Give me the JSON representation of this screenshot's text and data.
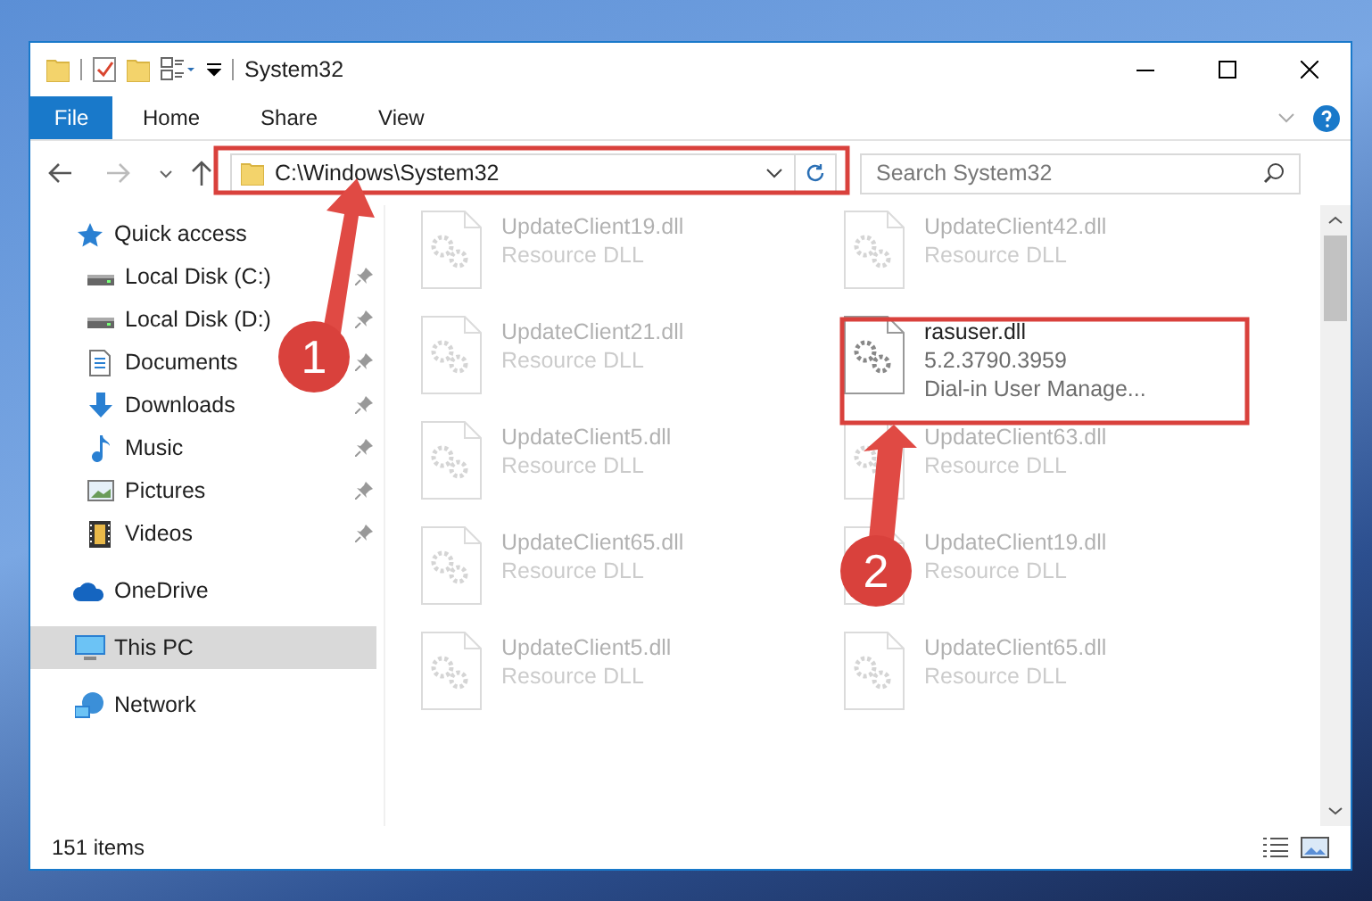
{
  "window": {
    "title": "System32"
  },
  "ribbon_tabs": [
    {
      "label": "File",
      "kind": "file"
    },
    {
      "label": "Home",
      "kind": "tab"
    },
    {
      "label": "Share",
      "kind": "tab"
    },
    {
      "label": "View",
      "kind": "tab"
    }
  ],
  "address_bar": {
    "path": "C:\\Windows\\System32"
  },
  "search": {
    "placeholder": "Search System32"
  },
  "sidebar": {
    "items": [
      {
        "label": "Quick access",
        "selected": false,
        "children": [
          {
            "label": "Local Disk (C:)",
            "pinned": true,
            "selected": false
          },
          {
            "label": "Local Disk (D:)",
            "pinned": true,
            "selected": false
          },
          {
            "label": "Documents",
            "pinned": true,
            "selected": false
          },
          {
            "label": "Downloads",
            "pinned": true,
            "selected": false
          },
          {
            "label": "Music",
            "pinned": true,
            "selected": false
          },
          {
            "label": "Pictures",
            "pinned": true,
            "selected": false
          },
          {
            "label": "Videos",
            "pinned": true,
            "selected": false
          }
        ]
      },
      {
        "label": "OneDrive",
        "selected": false
      },
      {
        "label": "This PC",
        "selected": true
      },
      {
        "label": "Network",
        "selected": false
      }
    ]
  },
  "files": [
    {
      "name": "UpdateClient19.dll",
      "details": [
        "Resource DLL"
      ],
      "blurred": true
    },
    {
      "name": "UpdateClient42.dll",
      "details": [
        "Resource DLL"
      ],
      "blurred": true
    },
    {
      "name": "UpdateClient21.dll",
      "details": [
        "Resource DLL"
      ],
      "blurred": true
    },
    {
      "name": "rasuser.dll",
      "details": [
        "5.2.3790.3959",
        "Dial-in User Manage..."
      ],
      "blurred": false
    },
    {
      "name": "UpdateClient5.dll",
      "details": [
        "Resource DLL"
      ],
      "blurred": true
    },
    {
      "name": "UpdateClient63.dll",
      "details": [
        "Resource DLL"
      ],
      "blurred": true
    },
    {
      "name": "UpdateClient65.dll",
      "details": [
        "Resource DLL"
      ],
      "blurred": true
    },
    {
      "name": "UpdateClient19.dll",
      "details": [
        "Resource DLL"
      ],
      "blurred": true
    },
    {
      "name": "UpdateClient5.dll",
      "details": [
        "Resource DLL"
      ],
      "blurred": true
    },
    {
      "name": "UpdateClient65.dll",
      "details": [
        "Resource DLL"
      ],
      "blurred": true
    }
  ],
  "status_bar": {
    "item_count": "151 items"
  },
  "annotations": [
    {
      "number": "1"
    },
    {
      "number": "2"
    }
  ]
}
